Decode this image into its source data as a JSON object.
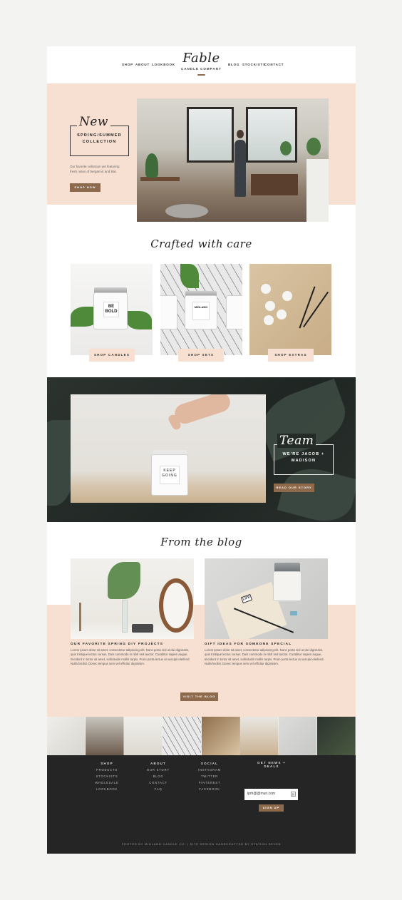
{
  "header": {
    "nav_left": [
      "SHOP",
      "ABOUT",
      "LOOKBOOK"
    ],
    "nav_right": [
      "BLOG",
      "STOCKISTS",
      "CONTACT"
    ],
    "logo": "Fable",
    "logo_sub": "CANDLE COMPANY"
  },
  "hero": {
    "script": "New",
    "collection": "SPRING/SUMMER COLLECTION",
    "description": "Our favorite collection yet featuring fresh notes of bergamot and lilac.",
    "button": "SHOP NOW"
  },
  "crafted": {
    "title": "Crafted with care",
    "tiles": [
      {
        "label": "SHOP CANDLES",
        "jar_text": "BE BOLD"
      },
      {
        "label": "SHOP SETS",
        "jar_text": "MIDLAND"
      },
      {
        "label": "SHOP EXTRAS"
      }
    ]
  },
  "team": {
    "script": "Team",
    "subtitle": "WE'RE JACOB + MADISON",
    "button": "READ OUR STORY",
    "jar_text": "KEEP GOING"
  },
  "blog": {
    "title": "From the blog",
    "posts": [
      {
        "title": "OUR FAVORITE SPRING DIY PROJECTS",
        "excerpt": "Lorem ipsum dolor sit amet, consectetur adipiscing elit. Nunc porta nisl ut dui dignissim, quis tristique lectus cursus. Duis commodo in nibh sed auctor. Curabitur sapien augue, tincidunt in tortor sit amet, sollicitudin mollis turpis. Proin porta lectus ut suscipit eleifend. Nulla facilisi. Donec tempus sem vel efficitur dignissim."
      },
      {
        "title": "GIFT IDEAS FOR SOMEONE SPECIAL",
        "excerpt": "Lorem ipsum dolor sit amet, consectetur adipiscing elit. Nunc porta nisl ut dui dignissim, quis tristique lectus cursus. Duis commodo in nibh sed auctor. Curabitur sapien augue, tincidunt in tortor sit amet, sollicitudin mollis turpis. Proin porta lectus ut suscipit eleifend. Nulla facilisi. Donec tempus sem vel efficitur dignissim."
      }
    ],
    "button": "VISIT THE BLOG"
  },
  "footer": {
    "columns": [
      {
        "heading": "SHOP",
        "links": [
          "PRODUCTS",
          "STOCKISTS",
          "WHOLESALE",
          "LOOKBOOK"
        ]
      },
      {
        "heading": "ABOUT",
        "links": [
          "OUR STORY",
          "BLOG",
          "CONTACT",
          "FAQ"
        ]
      },
      {
        "heading": "SOCIAL",
        "links": [
          "INSTAGRAM",
          "TWITTER",
          "PINTEREST",
          "FACEBOOK"
        ]
      }
    ],
    "newsletter_heading": "GET NEWS + DEALS",
    "email_value": "lprh@@mun.com",
    "signup": "SIGN UP",
    "credit": "PHOTOS BY MIDLAND CANDLE CO. | SITE DESIGN HANDCRAFTED BY STATION SEVEN"
  },
  "colors": {
    "accent": "#8e6a4c",
    "blush": "#f7e0d2",
    "dark": "#252525"
  }
}
